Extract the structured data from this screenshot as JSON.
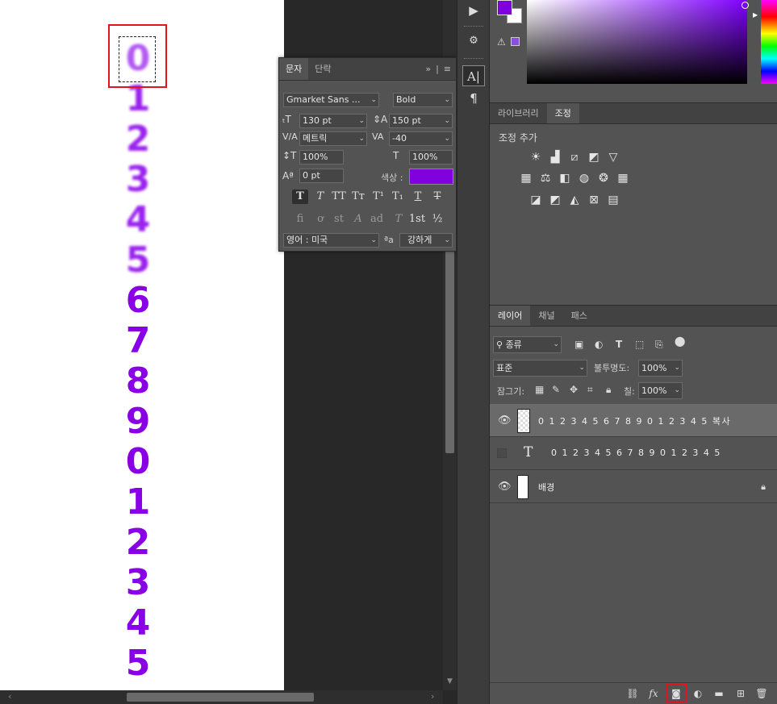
{
  "canvas": {
    "digits": [
      "0",
      "1",
      "2",
      "3",
      "4",
      "5",
      "6",
      "7",
      "8",
      "9",
      "0",
      "1",
      "2",
      "3",
      "4",
      "5"
    ]
  },
  "character_panel": {
    "tabs": [
      "문자",
      "단락"
    ],
    "font_family": "Gmarket Sans ...",
    "font_style": "Bold",
    "font_size": "130 pt",
    "leading": "150 pt",
    "kerning": "메트릭",
    "tracking": "-40",
    "vertical_scale": "100%",
    "horizontal_scale": "100%",
    "baseline_shift": "0 pt",
    "color_label": "색상 :",
    "color": "#8000e0",
    "type_buttons": [
      "T",
      "T",
      "TT",
      "Tт",
      "T¹",
      "T₁",
      "T",
      "T"
    ],
    "opentype_buttons": [
      "fi",
      "ơ",
      "st",
      "A",
      "ad",
      "T",
      "1st",
      "½"
    ],
    "language": "영어 : 미국",
    "aa_label": "ªa",
    "antialias": "강하게"
  },
  "color_panel": {
    "foreground": "#7e00e0",
    "background": "#ffffff"
  },
  "adjustments_panel": {
    "tabs": [
      "라이브러리",
      "조정"
    ],
    "title": "조정 추가"
  },
  "layers_panel": {
    "tabs": [
      "레이어",
      "채널",
      "패스"
    ],
    "filter_kind": "종류",
    "blend_mode": "표준",
    "opacity_label": "불투명도:",
    "opacity": "100%",
    "lock_label": "잠그기:",
    "fill_label": "칠:",
    "fill": "100%",
    "layers": [
      {
        "name": "0 1 2 3 4 5 6 7 8 9 0 1 2 3 4 5 복사",
        "visible": true,
        "selected": true
      },
      {
        "name": "0 1 2 3 4 5 6 7 8 9 0 1 2 3 4 5",
        "visible": false,
        "selected": false
      },
      {
        "name": "배경",
        "visible": true,
        "selected": false
      }
    ]
  }
}
